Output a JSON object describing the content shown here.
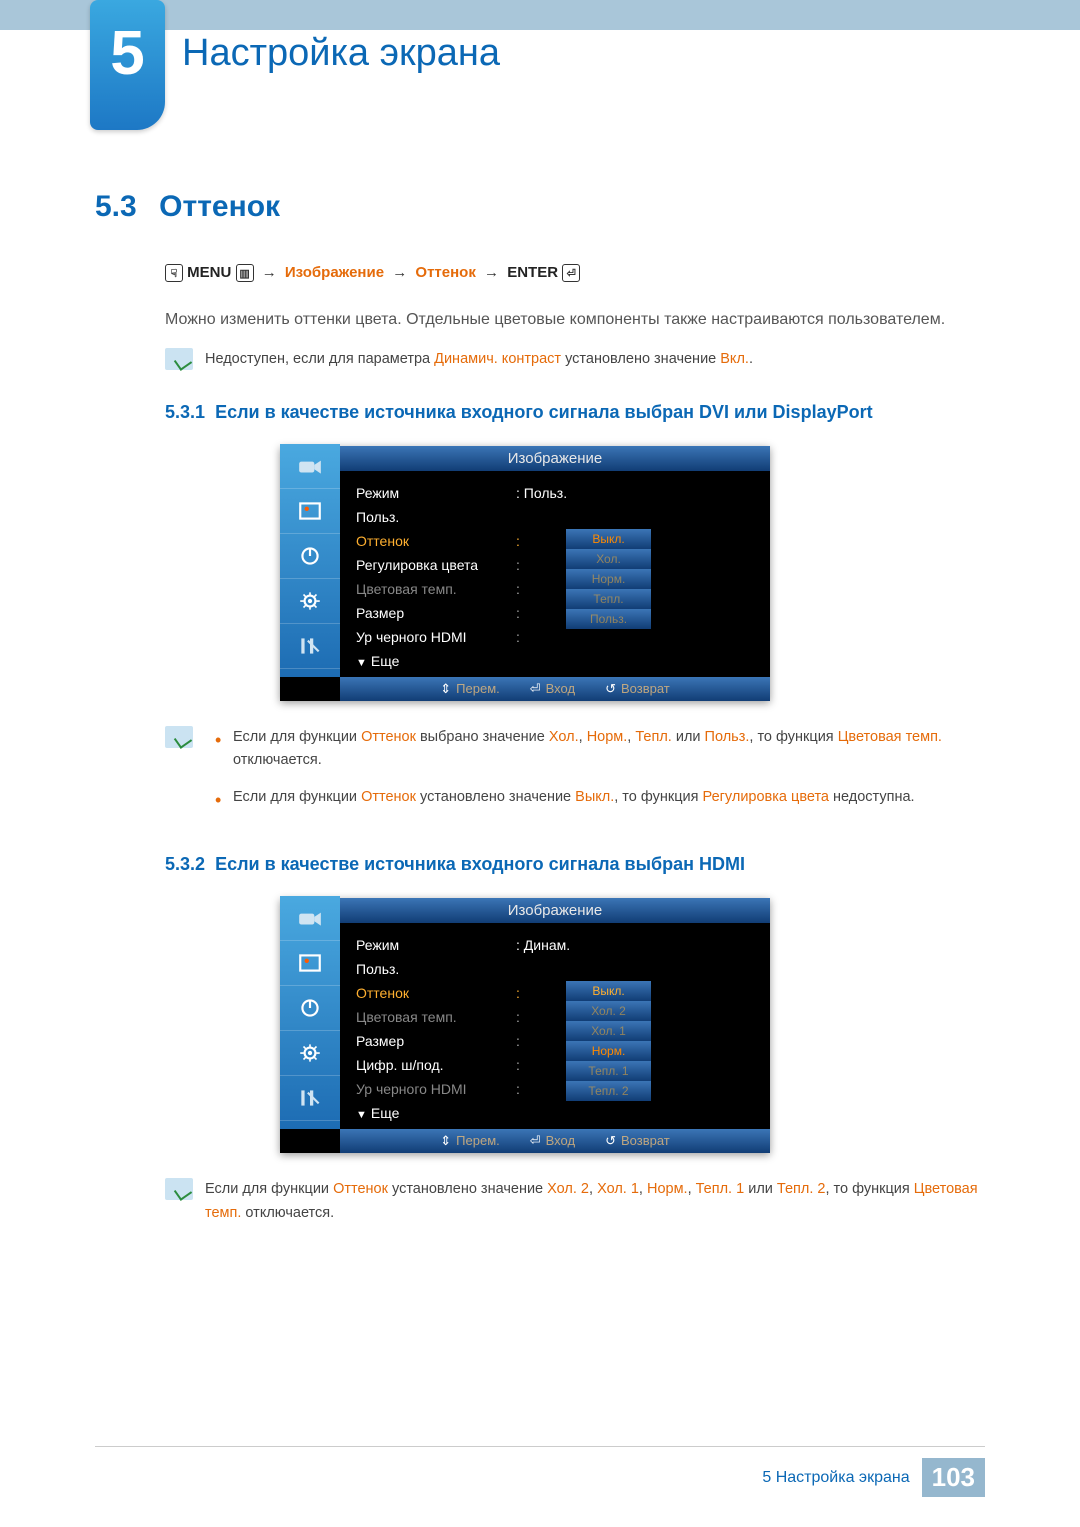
{
  "chapter": {
    "number": "5",
    "title": "Настройка экрана"
  },
  "section": {
    "number": "5.3",
    "title": "Оттенок"
  },
  "nav": {
    "menu_label": "MENU",
    "path1": "Изображение",
    "path2": "Оттенок",
    "enter_label": "ENTER"
  },
  "intro": "Можно изменить оттенки цвета. Отдельные цветовые компоненты также настраиваются пользователем.",
  "note1": {
    "pre": "Недоступен, если для параметра ",
    "a": "Динамич. контраст",
    "mid": " установлено значение ",
    "b": "Вкл.",
    "post": "."
  },
  "sub1": {
    "num": "5.3.1",
    "title": "Если в качестве источника входного сигнала выбран DVI или DisplayPort"
  },
  "osd1": {
    "title": "Изображение",
    "labels": [
      "Режим",
      "Польз.",
      "Оттенок",
      "Регулировка цвета",
      "Цветовая темп.",
      "Размер",
      "Ур черного HDMI"
    ],
    "more": "Еще",
    "value_mode": ": Польз.",
    "values": [
      ":",
      ":",
      ":",
      ":",
      ":"
    ],
    "opts": [
      "Выкл.",
      "Хол.",
      "Норм.",
      "Тепл.",
      "Польз."
    ],
    "footer": {
      "move": "Перем.",
      "enter": "Вход",
      "return": "Возврат"
    }
  },
  "note2": {
    "li1": {
      "p1": "Если для функции ",
      "a": "Оттенок",
      "p2": " выбрано значение ",
      "b": "Хол.",
      "c": "Норм.",
      "d": "Тепл.",
      "p3": " или ",
      "e": "Польз.",
      "p4": ", то функция ",
      "f": "Цветовая темп.",
      "p5": " отключается."
    },
    "li2": {
      "p1": "Если для функции ",
      "a": "Оттенок",
      "p2": " установлено значение ",
      "b": "Выкл.",
      "p3": ", то функция ",
      "c": "Регулировка цвета",
      "p4": " недоступна."
    }
  },
  "sub2": {
    "num": "5.3.2",
    "title": "Если в качестве источника входного сигнала выбран HDMI"
  },
  "osd2": {
    "title": "Изображение",
    "labels": [
      "Режим",
      "Польз.",
      "Оттенок",
      "Цветовая темп.",
      "Размер",
      "Цифр. ш/под.",
      "Ур черного HDMI"
    ],
    "more": "Еще",
    "value_mode": ": Динам.",
    "values": [
      ":",
      ":",
      ":",
      ":",
      ":"
    ],
    "opts": [
      "Выкл.",
      "Хол. 2",
      "Хол. 1",
      "Норм.",
      "Тепл. 1",
      "Тепл. 2"
    ],
    "footer": {
      "move": "Перем.",
      "enter": "Вход",
      "return": "Возврат"
    }
  },
  "note3": {
    "p1": "Если для функции ",
    "a": "Оттенок",
    "p2": " установлено значение ",
    "b": "Хол. 2",
    "c": "Хол. 1",
    "d": "Норм.",
    "e": "Тепл. 1",
    "p3": " или ",
    "f": "Тепл. 2",
    "p4": ", то функция ",
    "g": "Цветовая темп.",
    "p5": " отключается."
  },
  "footer": {
    "label": "5 Настройка экрана",
    "page": "103"
  }
}
